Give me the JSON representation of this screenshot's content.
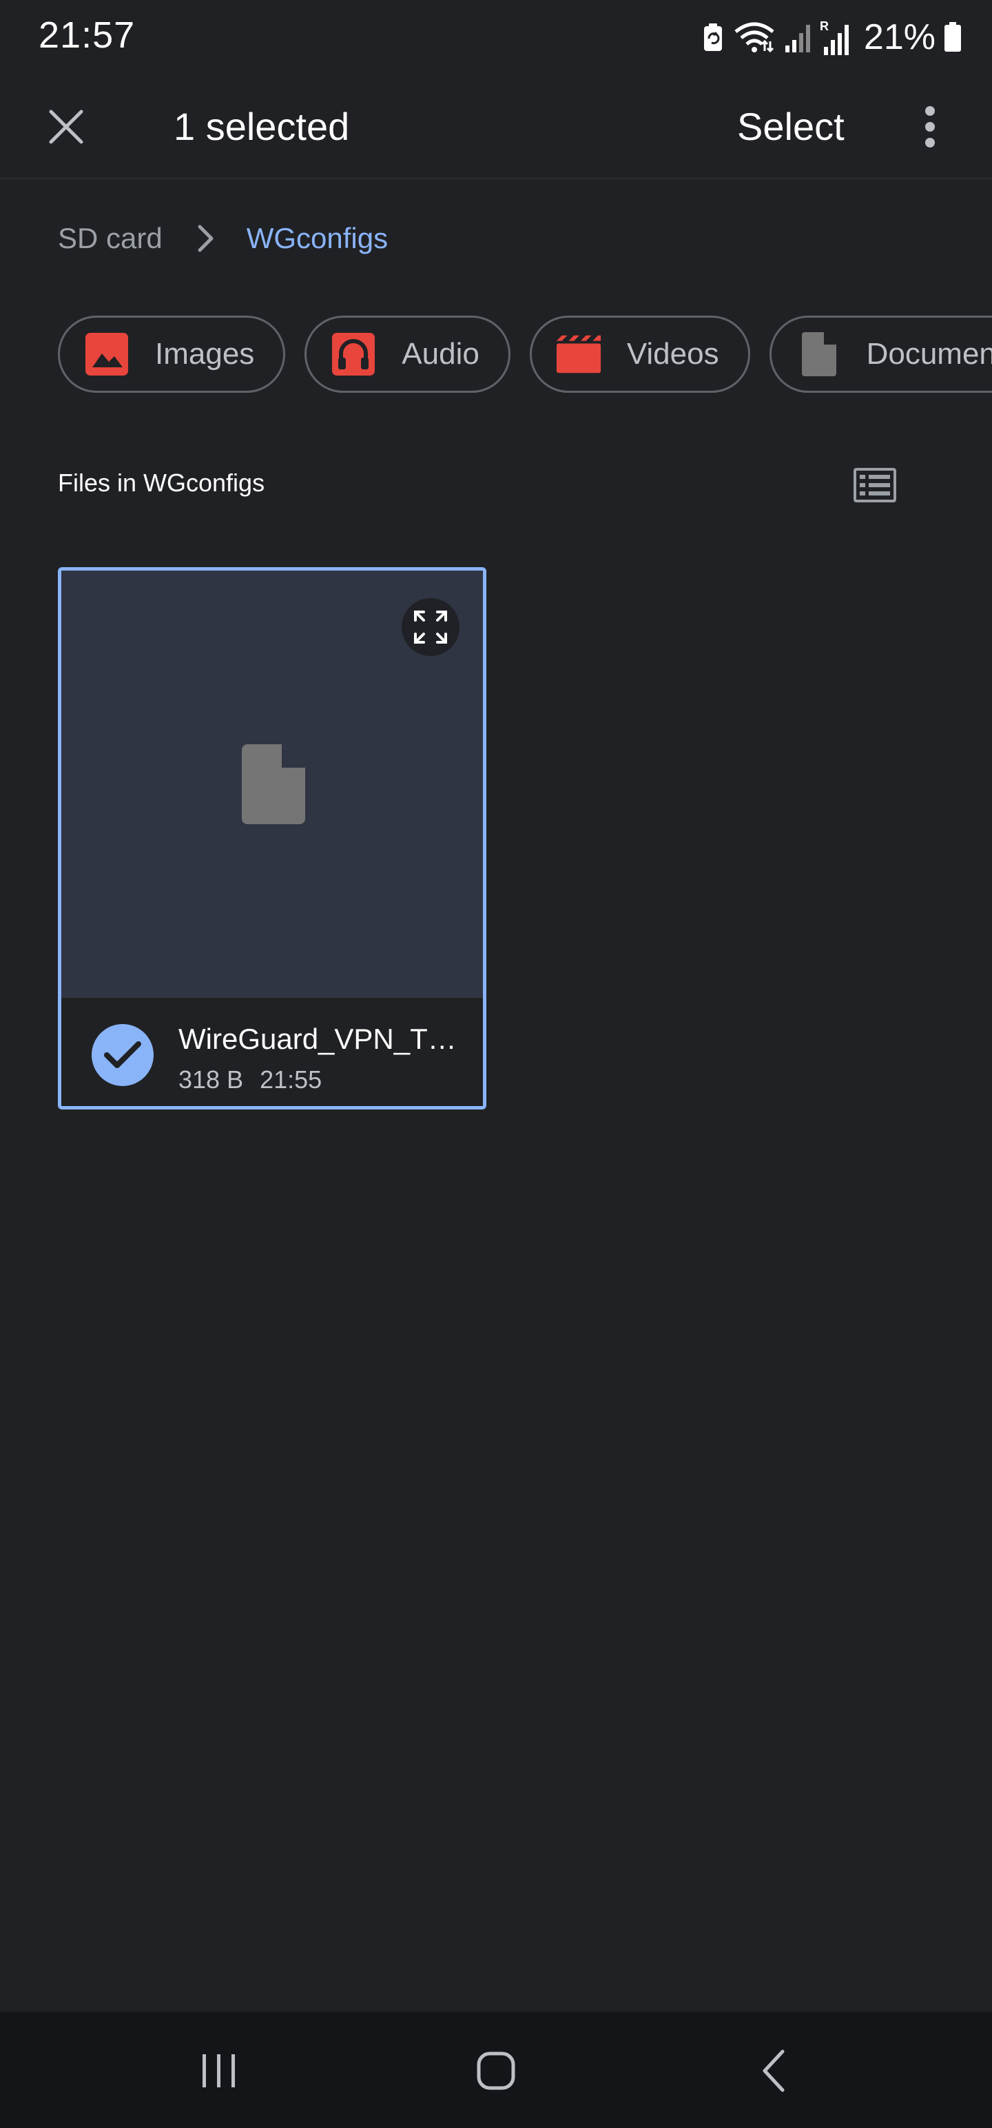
{
  "status_bar": {
    "time": "21:57",
    "battery_percent": "21%",
    "icons": [
      "battery-saver-icon",
      "wifi-icon",
      "signal-icon",
      "roaming-signal-icon",
      "battery-icon"
    ]
  },
  "app_bar": {
    "title": "1 selected",
    "select_label": "Select",
    "close_icon": "close-icon",
    "more_icon": "more-vert-icon"
  },
  "breadcrumb": {
    "root": "SD card",
    "current": "WGconfigs"
  },
  "chips": [
    {
      "label": "Images",
      "icon": "image-icon",
      "color": "#e8453c"
    },
    {
      "label": "Audio",
      "icon": "headphones-icon",
      "color": "#e8453c"
    },
    {
      "label": "Videos",
      "icon": "clapperboard-icon",
      "color": "#e8453c"
    },
    {
      "label": "Documents",
      "icon": "document-icon",
      "color": "#757575"
    }
  ],
  "section": {
    "title": "Files in WGconfigs",
    "view_icon": "list-view-icon"
  },
  "files": [
    {
      "name": "WireGuard_VPN_T…",
      "size": "318 B",
      "time": "21:55",
      "selected": true
    }
  ],
  "colors": {
    "accent": "#8ab4f8",
    "background": "#202124",
    "thumbnail": "#2f3542",
    "chip_icon_red": "#e8453c"
  },
  "nav_bar": {
    "icons": [
      "recent-apps-icon",
      "home-icon",
      "back-icon"
    ]
  }
}
